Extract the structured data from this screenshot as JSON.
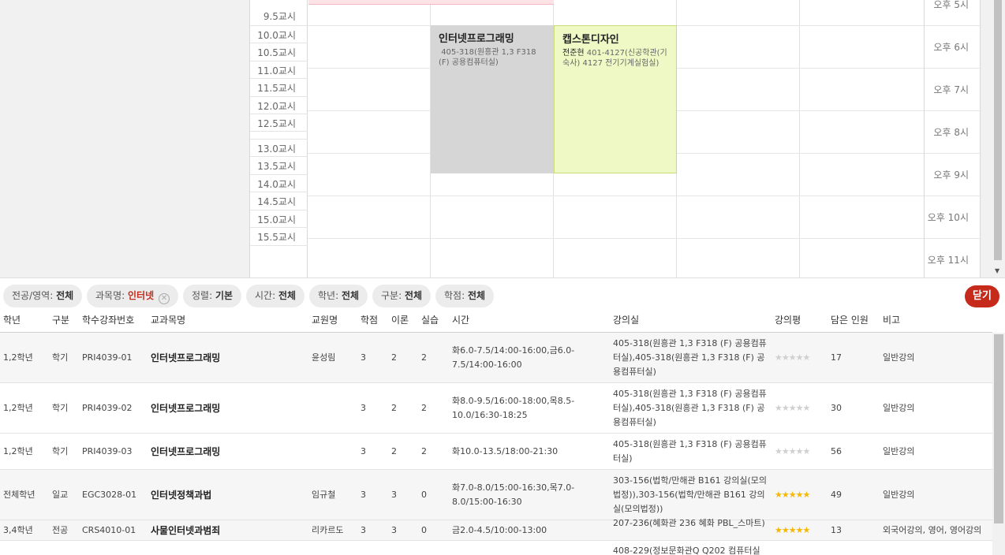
{
  "timetable": {
    "periods": [
      "9.5교시",
      "10.0교시",
      "10.5교시",
      "11.0교시",
      "11.5교시",
      "12.0교시",
      "12.5교시",
      "13.0교시",
      "13.5교시",
      "14.0교시",
      "14.5교시",
      "15.0교시",
      "15.5교시"
    ],
    "hours": [
      "오후 5시",
      "오후 6시",
      "오후 7시",
      "오후 8시",
      "오후 9시",
      "오후 10시",
      "오후 11시"
    ],
    "blocks": [
      {
        "name": "인터넷프로그래밍",
        "professor": "",
        "room": "405-318(원흥관 1,3 F318 (F) 공용컴퓨터실)",
        "color": "#d6d6d6"
      },
      {
        "name": "캡스톤디자인",
        "professor": "전준현",
        "room": "401-4127(신공학관(기숙사) 4127 전기기계실험실)",
        "color": "#eff9c6"
      }
    ]
  },
  "filters": [
    {
      "label": "전공/영역:",
      "value": "전체"
    },
    {
      "label": "과목명:",
      "value": "인터넷",
      "removable": true
    },
    {
      "label": "정렬:",
      "value": "기본"
    },
    {
      "label": "시간:",
      "value": "전체"
    },
    {
      "label": "학년:",
      "value": "전체"
    },
    {
      "label": "구분:",
      "value": "전체"
    },
    {
      "label": "학점:",
      "value": "전체"
    }
  ],
  "close_label": "닫기",
  "table": {
    "headers": [
      "학년",
      "구분",
      "학수강좌번호",
      "교과목명",
      "교원명",
      "학점",
      "이론",
      "실습",
      "시간",
      "강의실",
      "강의평",
      "담은 인원",
      "비고"
    ],
    "rows": [
      {
        "grade": "1,2학년",
        "type": "학기",
        "code": "PRI4039-01",
        "name": "인터넷프로그래밍",
        "prof": "윤성림",
        "credit": "3",
        "theory": "2",
        "practice": "2",
        "time": "화6.0-7.5/14:00-16:00,금6.0-7.5/14:00-16:00",
        "room": "405-318(원흥관 1,3 F318 (F) 공용컴퓨터실),405-318(원흥관 1,3 F318 (F) 공용컴퓨터실)",
        "rating": 0,
        "count": "17",
        "note": "일반강의"
      },
      {
        "grade": "1,2학년",
        "type": "학기",
        "code": "PRI4039-02",
        "name": "인터넷프로그래밍",
        "prof": "",
        "credit": "3",
        "theory": "2",
        "practice": "2",
        "time": "화8.0-9.5/16:00-18:00,목8.5-10.0/16:30-18:25",
        "room": "405-318(원흥관 1,3 F318 (F) 공용컴퓨터실),405-318(원흥관 1,3 F318 (F) 공용컴퓨터실)",
        "rating": 0,
        "count": "30",
        "note": "일반강의"
      },
      {
        "grade": "1,2학년",
        "type": "학기",
        "code": "PRI4039-03",
        "name": "인터넷프로그래밍",
        "prof": "",
        "credit": "3",
        "theory": "2",
        "practice": "2",
        "time": "화10.0-13.5/18:00-21:30",
        "room": "405-318(원흥관 1,3 F318 (F) 공용컴퓨터실)",
        "rating": 0,
        "count": "56",
        "note": "일반강의"
      },
      {
        "grade": "전체학년",
        "type": "일교",
        "code": "EGC3028-01",
        "name": "인터넷정책과법",
        "prof": "임규철",
        "credit": "3",
        "theory": "3",
        "practice": "0",
        "time": "화7.0-8.0/15:00-16:30,목7.0-8.0/15:00-16:30",
        "room": "303-156(법학/만해관 B161 강의실(모의법정)),303-156(법학/만해관 B161 강의실(모의법정))",
        "rating": 4.5,
        "count": "49",
        "note": "일반강의"
      },
      {
        "grade": "3,4학년",
        "type": "전공",
        "code": "CRS4010-01",
        "name": "사물인터넷과범죄",
        "prof": "리카르도",
        "credit": "3",
        "theory": "3",
        "practice": "0",
        "time": "금2.0-4.5/10:00-13:00",
        "room": "207-236(혜화관 236 혜화 PBL_스마트)",
        "rating": 4.5,
        "count": "13",
        "note": "외국어강의, 영어, 영어강의"
      },
      {
        "grade": "",
        "type": "",
        "code": "",
        "name": "",
        "prof": "",
        "credit": "",
        "theory": "",
        "practice": "",
        "time": "",
        "room": "408-229(정보문화관Q Q202 컴퓨터실",
        "rating": -1,
        "count": "",
        "note": ""
      }
    ]
  }
}
